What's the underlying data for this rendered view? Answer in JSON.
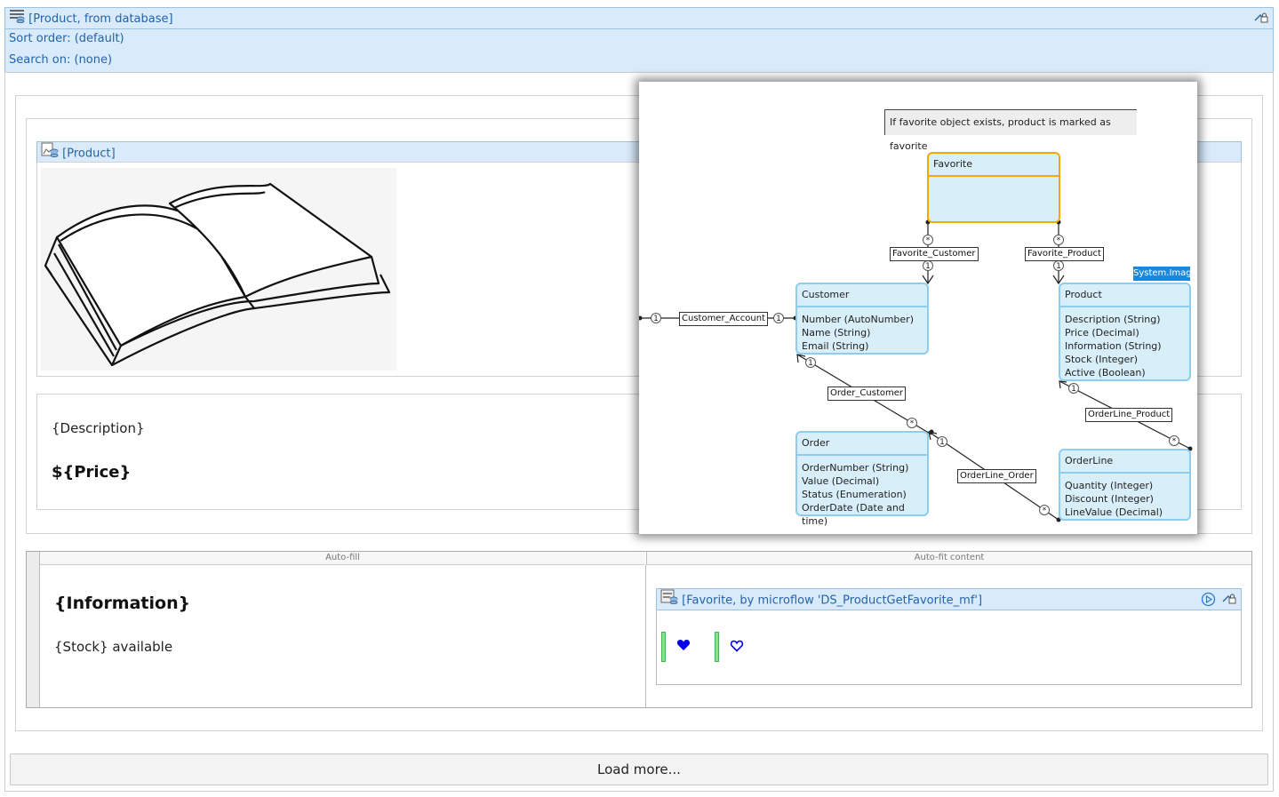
{
  "top_list": {
    "header": "[Product, from database]",
    "sort_order": "Sort order: (default)",
    "search_on": "Search on: (none)"
  },
  "product_view": {
    "header": "[Product]",
    "description": "{Description}",
    "price": "${Price}"
  },
  "columns": {
    "left_header": "Auto-fill",
    "right_header": "Auto-fit content"
  },
  "info": {
    "title": "{Information}",
    "stock": "{Stock} available"
  },
  "favorite_view": {
    "header": "[Favorite, by microflow 'DS_ProductGetFavorite_mf']"
  },
  "load_more": "Load more...",
  "diagram": {
    "note": "If favorite object exists, product is marked as favorite",
    "system_image": "System.Image",
    "entities": {
      "favorite": {
        "title": "Favorite",
        "attributes": []
      },
      "customer": {
        "title": "Customer",
        "attributes": [
          "Number (AutoNumber)",
          "Name (String)",
          "Email (String)"
        ]
      },
      "product": {
        "title": "Product",
        "attributes": [
          "Description (String)",
          "Price (Decimal)",
          "Information (String)",
          "Stock (Integer)",
          "Active (Boolean)"
        ]
      },
      "order": {
        "title": "Order",
        "attributes": [
          "OrderNumber (String)",
          "Value (Decimal)",
          "Status (Enumeration)",
          "OrderDate (Date and time)"
        ]
      },
      "orderline": {
        "title": "OrderLine",
        "attributes": [
          "Quantity (Integer)",
          "Discount (Integer)",
          "LineValue (Decimal)"
        ]
      }
    },
    "associations": {
      "favorite_customer": "Favorite_Customer",
      "favorite_product": "Favorite_Product",
      "customer_account": "Customer_Account",
      "order_customer": "Order_Customer",
      "orderline_product": "OrderLine_Product",
      "orderline_order": "OrderLine_Order"
    },
    "multiplicity": {
      "one": "1",
      "many": "*"
    }
  },
  "colors": {
    "header_bg": "#d9ebfb",
    "header_text": "#2264a8",
    "entity_fill": "#d8eef9",
    "entity_border": "#8fcdee",
    "favorite_border": "#f2a900",
    "heart": "#0000ee",
    "green_bar": "#8ee08a"
  }
}
